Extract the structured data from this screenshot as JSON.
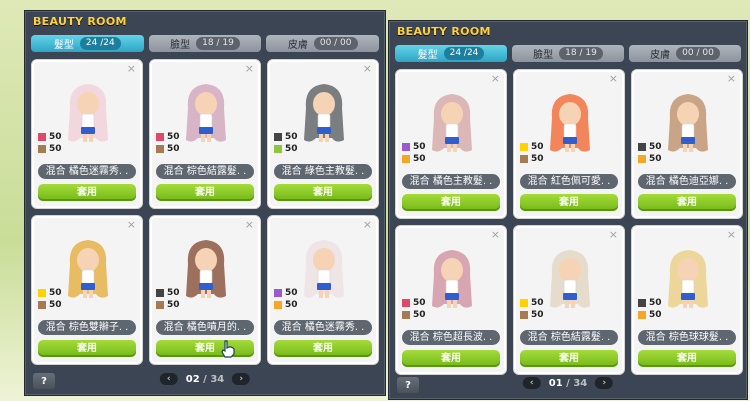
{
  "colors": {
    "tab_active": "#2ea5c6",
    "apply_green": "#73b818",
    "title_yellow": "#ffd23a"
  },
  "left": {
    "title": "BEAUTY ROOM",
    "tabs": [
      {
        "label": "髮型",
        "count": "24 /24",
        "active": true
      },
      {
        "label": "臉型",
        "count": "18 / 19",
        "active": false
      },
      {
        "label": "皮膚",
        "count": "00 / 00",
        "active": false
      }
    ],
    "cards": [
      {
        "name": "混合  橘色迷霧秀. .",
        "c1": "#e04a6a",
        "c2": "#a67a52",
        "v1": "50",
        "v2": "50",
        "hair": "#f3d7df",
        "apply": "套用",
        "close": "×"
      },
      {
        "name": "混合  棕色結露髮. .",
        "c1": "#e04a6a",
        "c2": "#a67a52",
        "v1": "50",
        "v2": "50",
        "hair": "#d7b4c6",
        "apply": "套用",
        "close": "×"
      },
      {
        "name": "混合  綠色主教髮. .",
        "c1": "#444444",
        "c2": "#8dc63f",
        "v1": "50",
        "v2": "50",
        "hair": "#7b7e80",
        "apply": "套用",
        "close": "×"
      },
      {
        "name": "混合  棕色雙辮子. .",
        "c1": "#ffd200",
        "c2": "#a67a52",
        "v1": "50",
        "v2": "50",
        "hair": "#e8bc62",
        "apply": "套用",
        "close": "×"
      },
      {
        "name": "混合  橘色噴月的. .",
        "c1": "#444444",
        "c2": "#a67a52",
        "v1": "50",
        "v2": "50",
        "hair": "#9c705c",
        "apply": "套用",
        "close": "×"
      },
      {
        "name": "混合  橘色迷霧秀. .",
        "c1": "#9b59d0",
        "c2": "#f5a623",
        "v1": "50",
        "v2": "50",
        "hair": "#efe4e6",
        "apply": "套用",
        "close": "×"
      }
    ],
    "help": "?",
    "page": "02",
    "total": "34",
    "prev": "‹",
    "next": "›"
  },
  "right": {
    "title": "BEAUTY ROOM",
    "tabs": [
      {
        "label": "髮型",
        "count": "24 /24",
        "active": true
      },
      {
        "label": "臉型",
        "count": "18 / 19",
        "active": false
      },
      {
        "label": "皮膚",
        "count": "00 / 00",
        "active": false
      }
    ],
    "cards": [
      {
        "name": "混合  橘色主教髮. .",
        "c1": "#9b59d0",
        "c2": "#f5a623",
        "v1": "50",
        "v2": "50",
        "hair": "#dcb7b7",
        "apply": "套用",
        "close": "×"
      },
      {
        "name": "混合  紅色佩可愛. .",
        "c1": "#ffd200",
        "c2": "#a67a52",
        "v1": "50",
        "v2": "50",
        "hair": "#f3855a",
        "apply": "套用",
        "close": "×"
      },
      {
        "name": "混合  橘色迪亞娜. .",
        "c1": "#444444",
        "c2": "#f5a623",
        "v1": "50",
        "v2": "50",
        "hair": "#c9a487",
        "apply": "套用",
        "close": "×"
      },
      {
        "name": "混合  棕色超長波. .",
        "c1": "#e04a6a",
        "c2": "#a67a52",
        "v1": "50",
        "v2": "50",
        "hair": "#d8a6b2",
        "apply": "套用",
        "close": "×"
      },
      {
        "name": "混合  棕色結露髮. .",
        "c1": "#ffd200",
        "c2": "#a67a52",
        "v1": "50",
        "v2": "50",
        "hair": "#e6dccb",
        "apply": "套用",
        "close": "×"
      },
      {
        "name": "混合  棕色球球髮. .",
        "c1": "#444444",
        "c2": "#f5a623",
        "v1": "50",
        "v2": "50",
        "hair": "#ecd69a",
        "apply": "套用",
        "close": "×"
      }
    ],
    "help": "?",
    "page": "01",
    "total": "34",
    "prev": "‹",
    "next": "›"
  }
}
